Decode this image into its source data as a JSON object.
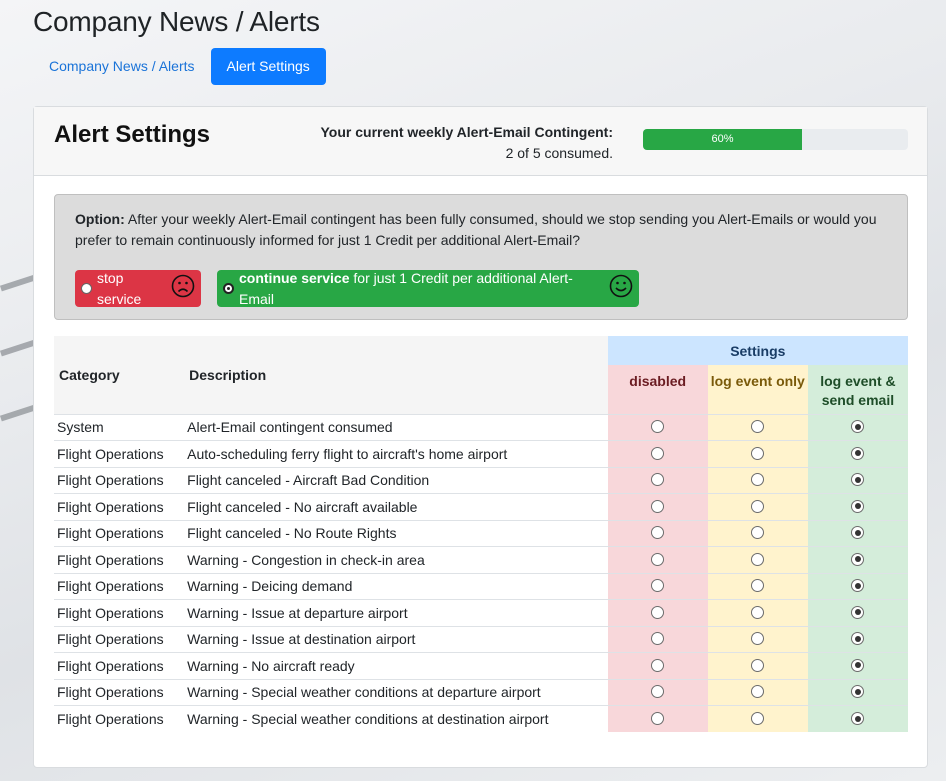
{
  "page": {
    "title": "Company News / Alerts"
  },
  "nav": [
    {
      "label": "Company News / Alerts",
      "active": false
    },
    {
      "label": "Alert Settings",
      "active": true
    }
  ],
  "card": {
    "title": "Alert Settings",
    "contingent_label": "Your current weekly Alert-Email Contingent:",
    "contingent_status": "2 of 5 consumed.",
    "progress": {
      "text": "60%",
      "percent": 60
    }
  },
  "option": {
    "label": "Option:",
    "text": "After your weekly Alert-Email contingent has been fully consumed, should we stop sending you Alert-Emails or would you prefer to remain continuously informed for just 1 Credit per additional Alert-Email?",
    "stop_label": "stop service",
    "continue_bold": "continue service",
    "continue_rest": " for just 1 Credit per additional Alert-Email",
    "selected": "continue"
  },
  "table": {
    "headers": {
      "category": "Category",
      "description": "Description",
      "settings": "Settings",
      "disabled": "disabled",
      "log_only": "log event only",
      "log_email": "log event & send email"
    },
    "rows": [
      {
        "category": "System",
        "description": "Alert-Email contingent consumed",
        "setting": "log_email"
      },
      {
        "category": "Flight Operations",
        "description": "Auto-scheduling ferry flight to aircraft's home airport",
        "setting": "log_email"
      },
      {
        "category": "Flight Operations",
        "description": "Flight canceled - Aircraft Bad Condition",
        "setting": "log_email"
      },
      {
        "category": "Flight Operations",
        "description": "Flight canceled - No aircraft available",
        "setting": "log_email"
      },
      {
        "category": "Flight Operations",
        "description": "Flight canceled - No Route Rights",
        "setting": "log_email"
      },
      {
        "category": "Flight Operations",
        "description": "Warning - Congestion in check-in area",
        "setting": "log_email"
      },
      {
        "category": "Flight Operations",
        "description": "Warning - Deicing demand",
        "setting": "log_email"
      },
      {
        "category": "Flight Operations",
        "description": "Warning - Issue at departure airport",
        "setting": "log_email"
      },
      {
        "category": "Flight Operations",
        "description": "Warning - Issue at destination airport",
        "setting": "log_email"
      },
      {
        "category": "Flight Operations",
        "description": "Warning - No aircraft ready",
        "setting": "log_email"
      },
      {
        "category": "Flight Operations",
        "description": "Warning - Special weather conditions at departure airport",
        "setting": "log_email"
      },
      {
        "category": "Flight Operations",
        "description": "Warning - Special weather conditions at destination airport",
        "setting": "log_email"
      }
    ]
  },
  "icons": {
    "stop_face": "sad-face-icon",
    "continue_face": "happy-face-icon"
  },
  "colors": {
    "primary": "#0d7bff",
    "success": "#28a745",
    "danger": "#dc3545",
    "settings_header": "#cce5ff",
    "disabled_bg": "#f8d7da",
    "log_bg": "#fff3cd",
    "email_bg": "#d4edda"
  }
}
